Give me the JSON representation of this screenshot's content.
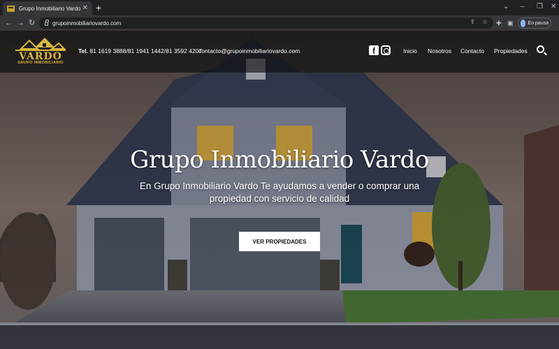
{
  "browser": {
    "tab_title": "Grupo Inmobiliario Vardo",
    "url": "grupoinmobiliariovardo.com",
    "profile_label": "En pausa"
  },
  "site": {
    "logo": {
      "name": "VARDO",
      "subtitle": "GRUPO INMOBILIARIO"
    },
    "contact": {
      "phone_label": "Tel.",
      "phones": "81 1619 3888/81 1941 1442/81 3592 4207",
      "email": "contacto@grupoinmobiliariovardo.com"
    },
    "social": {
      "facebook": "f"
    },
    "nav": [
      "Inicio",
      "Nosotros",
      "Contacto",
      "Propiedades"
    ],
    "hero": {
      "title": "Grupo Inmobiliario Vardo",
      "subtitle": "En Grupo Inmobiliario Vardo Te ayudamos a vender o comprar una propiedad con servicio de calidad",
      "cta": "VER PROPIEDADES"
    }
  },
  "colors": {
    "brand_gold": "#d8b640",
    "header_bg": "#0a0a0c",
    "chrome_bg": "#202124",
    "toolbar_bg": "#35363a"
  },
  "icons": [
    "tab-favicon-icon",
    "close-icon",
    "plus-icon",
    "back-icon",
    "forward-icon",
    "reload-icon",
    "lock-icon",
    "share-icon",
    "star-icon",
    "extensions-icon",
    "sidepanel-icon",
    "facebook-icon",
    "instagram-icon",
    "search-icon"
  ]
}
